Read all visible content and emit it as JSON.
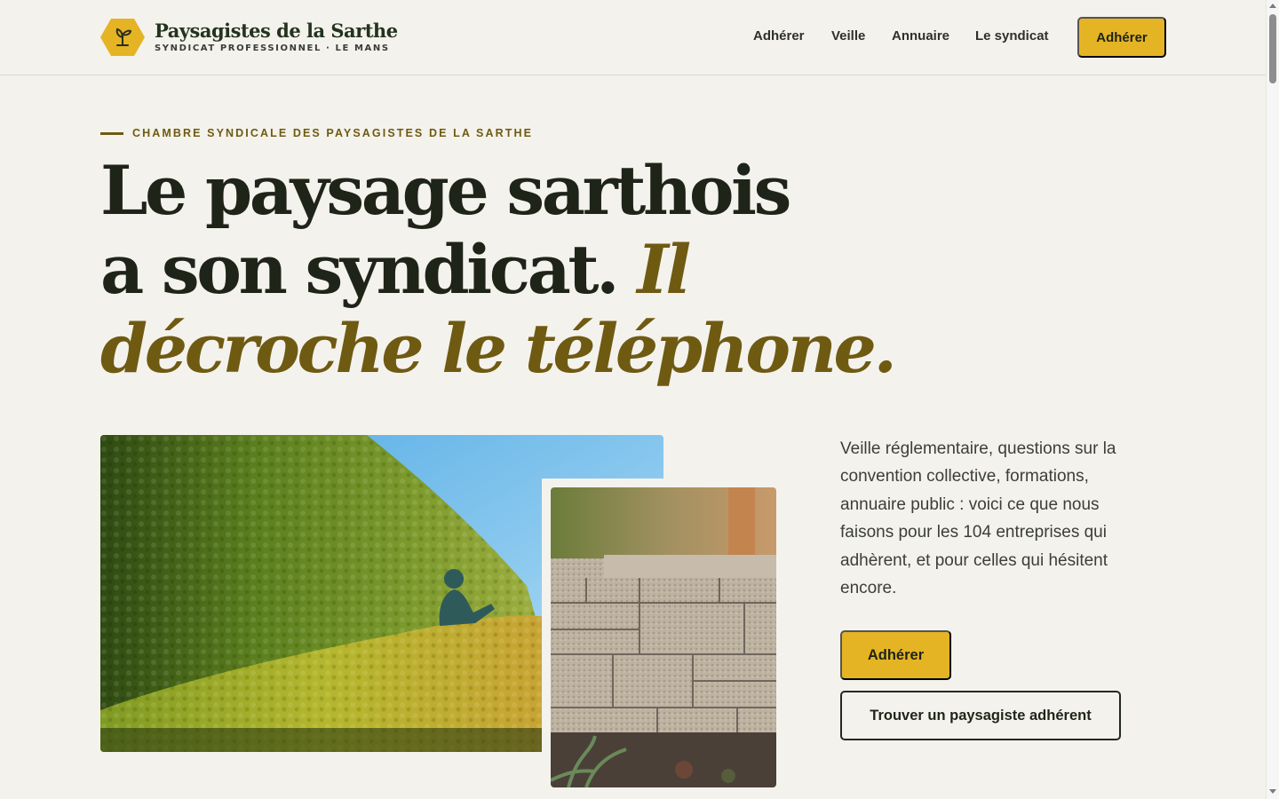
{
  "brand": {
    "name": "Paysagistes de la Sarthe",
    "tagline": "SYNDICAT PROFESSIONNEL · LE MANS",
    "logo_icon": "seedling-icon"
  },
  "nav": {
    "items": [
      {
        "label": "Adhérer"
      },
      {
        "label": "Veille"
      },
      {
        "label": "Annuaire"
      },
      {
        "label": "Le syndicat"
      }
    ],
    "cta_label": "Adhérer"
  },
  "hero": {
    "eyebrow": "CHAMBRE SYNDICALE DES PAYSAGISTES DE LA SARTHE",
    "headline_line1": "Le paysage sarthois",
    "headline_line2_plain": "a son syndicat. ",
    "headline_line2_accent": "Il",
    "headline_line3_accent": "décroche le téléphone.",
    "lead": "Veille réglementaire, questions sur la convention collective, formations, annuaire public : voici ce que nous faisons pour les 104 entreprises qui adhèrent, et pour celles qui hésitent encore.",
    "primary_cta": "Adhérer",
    "secondary_cta": "Trouver un paysagiste adhérent"
  },
  "colors": {
    "background": "#f4f2ec",
    "accent_gold": "#e5b424",
    "accent_olive": "#6f5a12",
    "text_dark": "#1f2419"
  }
}
